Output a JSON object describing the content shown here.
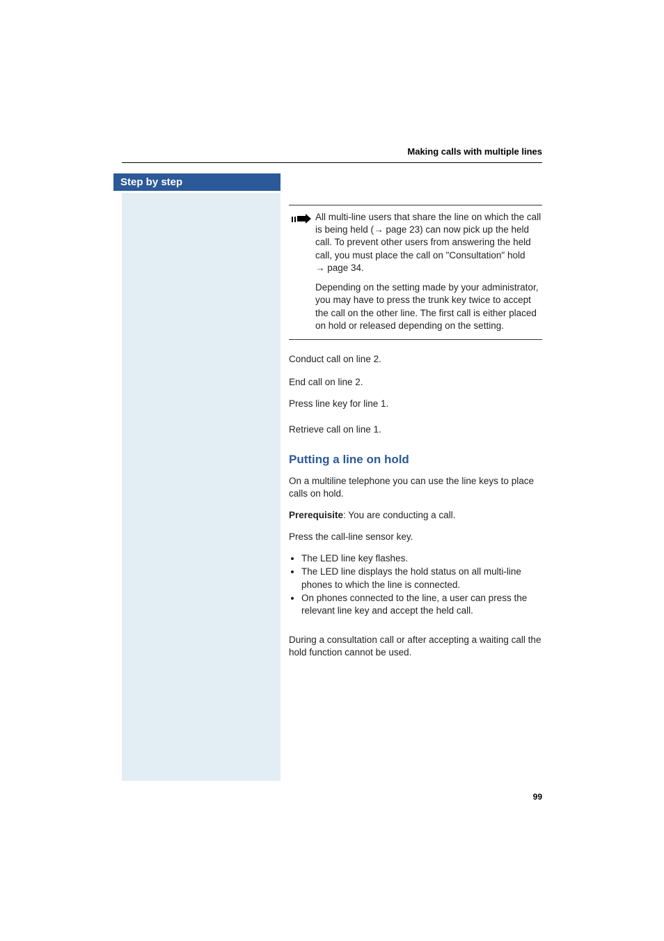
{
  "header": {
    "title": "Making calls with multiple lines"
  },
  "sidebar": {
    "banner": "Step by step"
  },
  "note": {
    "para1_pre": "All multi-line users that share the line on which the call is being held (",
    "para1_link": "page 23",
    "para1_mid": ") can now pick up the held call. To prevent other users from answering the held call, you must place the call on \"Consultation\" hold ",
    "para1_link2": "page 34",
    "para1_post": ".",
    "para2": "Depending on the setting made by your administrator, you may have to press the trunk key twice to accept the call on the other line. The first call is either placed on hold or released depending on the setting."
  },
  "steps": {
    "s1": "Conduct call on line 2.",
    "s2": "End call on line 2.",
    "s3": "Press line key for line 1.",
    "s4": "Retrieve call on line 1."
  },
  "section": {
    "heading": "Putting a line on hold",
    "intro": "On a multiline telephone you can use the line keys to place calls on hold.",
    "prereq_label": "Prerequisite",
    "prereq_text": ": You are conducting a call.",
    "step_press": "Press the call-line sensor key.",
    "bullets": {
      "b1": "The LED line key flashes.",
      "b2": "The LED line displays the hold status on all multi-line phones to which the line is connected.",
      "b3": "On phones connected to the line, a user can press the relevant line key and accept the held call."
    },
    "outro": "During a consultation call or after accepting a waiting call the hold function cannot be used."
  },
  "page_number": "99"
}
